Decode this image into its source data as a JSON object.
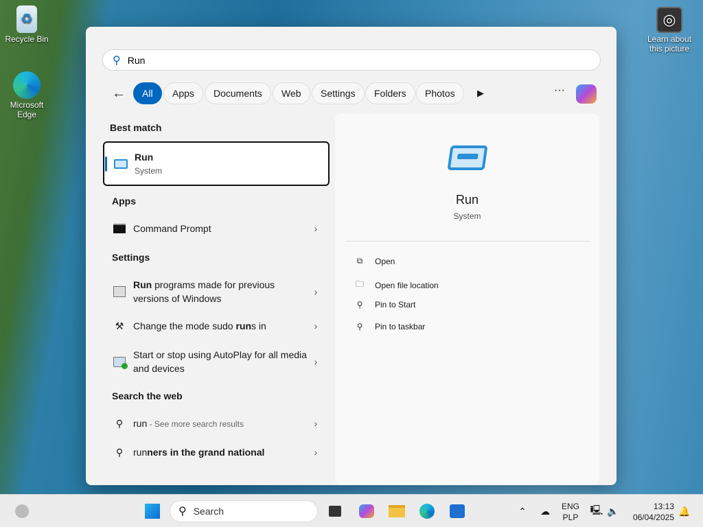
{
  "desktop": {
    "icons": [
      {
        "label": "Recycle Bin"
      },
      {
        "label": "Microsoft Edge"
      }
    ],
    "learn": "Learn about this picture"
  },
  "search": {
    "value": "Run",
    "placeholder": "Search"
  },
  "filters": [
    "All",
    "Apps",
    "Documents",
    "Web",
    "Settings",
    "Folders",
    "Photos"
  ],
  "sections": {
    "best": "Best match",
    "apps": "Apps",
    "settings": "Settings",
    "web": "Search the web"
  },
  "best_match": {
    "title": "Run",
    "subtitle": "System"
  },
  "apps": [
    {
      "label": "Command Prompt"
    }
  ],
  "settings": [
    {
      "bold": "Run",
      "rest": " programs made for previous versions of Windows"
    },
    {
      "pre": "Change the mode sudo ",
      "bold": "run",
      "rest": "s in"
    },
    {
      "label": "Start or stop using AutoPlay for all media and devices"
    }
  ],
  "web": [
    {
      "term": "run",
      "hint": " - See more search results"
    },
    {
      "pre": "run",
      "bold": "ners in the grand national"
    }
  ],
  "preview": {
    "title": "Run",
    "subtitle": "System",
    "actions": [
      "Open",
      "Open file location",
      "Pin to Start",
      "Pin to taskbar"
    ]
  },
  "taskbar": {
    "search_label": "Search",
    "lang1": "ENG",
    "lang2": "PLP",
    "time": "13:13",
    "date": "06/04/2025"
  },
  "colors": {
    "accent": "#0067c0"
  }
}
